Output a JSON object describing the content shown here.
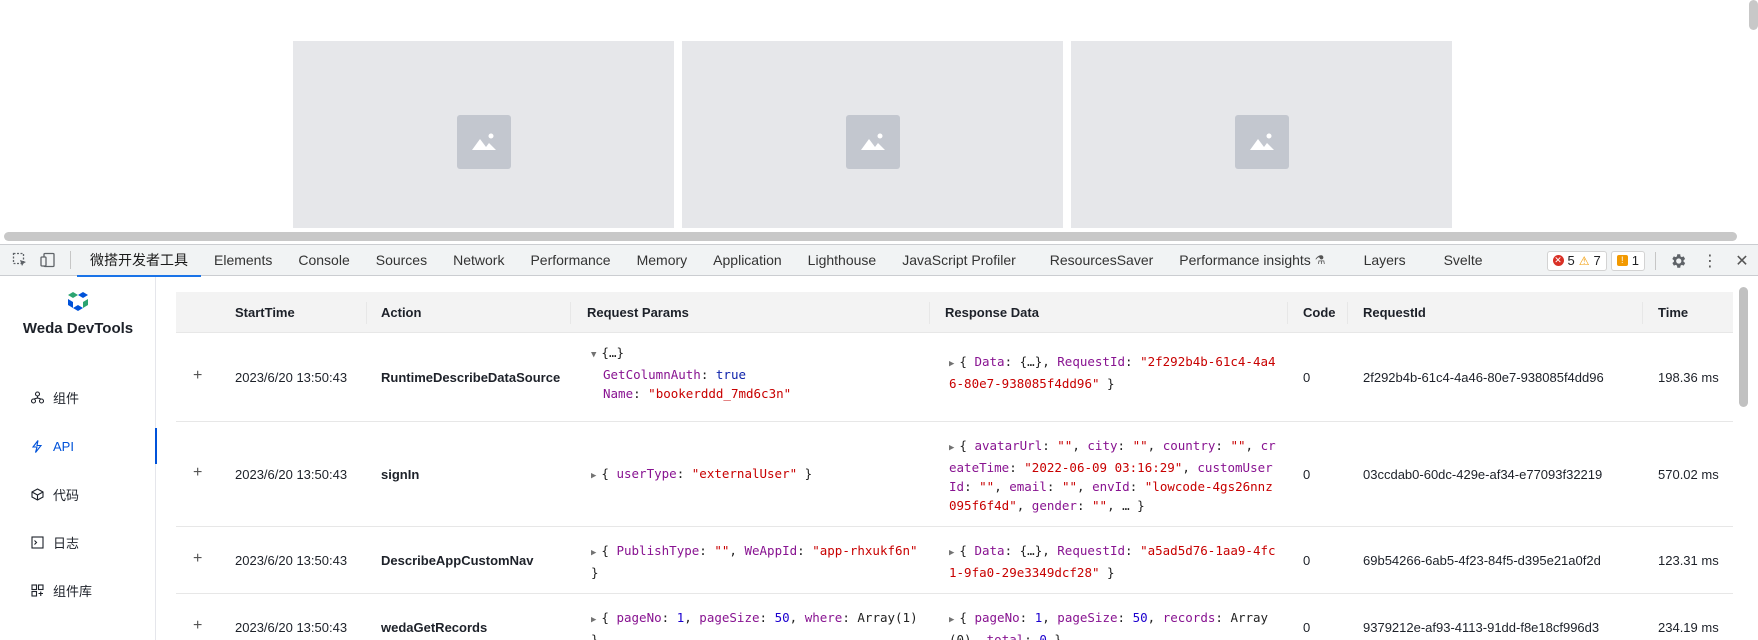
{
  "devtools": {
    "tabs": [
      "微搭开发者工具",
      "Elements",
      "Console",
      "Sources",
      "Network",
      "Performance",
      "Memory",
      "Application",
      "Lighthouse",
      "JavaScript Profiler",
      "ResourcesSaver",
      "Performance insights",
      "Layers",
      "Svelte"
    ],
    "active_tab": "微搭开发者工具",
    "issues": {
      "errors": "5",
      "warnings": "7",
      "info": "1"
    }
  },
  "sidebar": {
    "logo_text": "Weda DevTools",
    "items": [
      {
        "label": "组件",
        "icon": "component-tree-icon"
      },
      {
        "label": "API",
        "icon": "lightning-icon"
      },
      {
        "label": "代码",
        "icon": "code-cube-icon"
      },
      {
        "label": "日志",
        "icon": "log-terminal-icon"
      },
      {
        "label": "组件库",
        "icon": "library-icon"
      }
    ],
    "active": "API"
  },
  "table": {
    "columns": [
      "StartTime",
      "Action",
      "Request Params",
      "Response Data",
      "Code",
      "RequestId",
      "Time"
    ],
    "rows": [
      {
        "start": "2023/6/20 13:50:43",
        "action": "RuntimeDescribeDataSource",
        "params": "{…} GetColumnAuth: true Name: \"bookerddd_7md6c3n\"",
        "response": "{ Data: {…}, RequestId: \"2f292b4b-61c4-4a46-80e7-938085f4dd96\" }",
        "code": "0",
        "request_id": "2f292b4b-61c4-4a46-80e7-938085f4dd96",
        "time": "198.36 ms"
      },
      {
        "start": "2023/6/20 13:50:43",
        "action": "signIn",
        "params": "{ userType: \"externalUser\" }",
        "response": "{ avatarUrl: \"\", city: \"\", country: \"\", createTime: \"2022-06-09 03:16:29\", customUserId: \"\", email: \"\", envId: \"lowcode-4gs26nnz095f6f4d\", gender: \"\", … }",
        "code": "0",
        "request_id": "03ccdab0-60dc-429e-af34-e77093f32219",
        "time": "570.02 ms"
      },
      {
        "start": "2023/6/20 13:50:43",
        "action": "DescribeAppCustomNav",
        "params": "{ PublishType: \"\", WeAppId: \"app-rhxukf6n\" }",
        "response": "{ Data: {…}, RequestId: \"a5ad5d76-1aa9-4fc1-9fa0-29e3349dcf28\" }",
        "code": "0",
        "request_id": "69b54266-6ab5-4f23-84f5-d395e21a0f2d",
        "time": "123.31 ms"
      },
      {
        "start": "2023/6/20 13:50:43",
        "action": "wedaGetRecords",
        "params": "{ pageNo: 1, pageSize: 50, where: Array(1) }",
        "response": "{ pageNo: 1, pageSize: 50, records: Array(0), total: 0 }",
        "code": "0",
        "request_id": "9379212e-af93-4113-91dd-f8e18cf996d3",
        "time": "234.19 ms"
      }
    ]
  },
  "colors": {
    "accent": "#1a73e8",
    "sidebar_active": "#0052d9",
    "string": "#c80000",
    "key": "#881391",
    "number": "#1c00cf"
  }
}
